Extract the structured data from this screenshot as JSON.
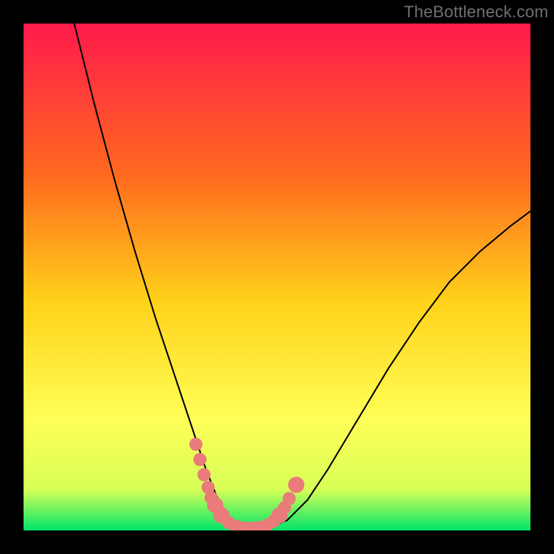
{
  "watermark": "TheBottleneck.com",
  "colors": {
    "frame": "#000000",
    "gradient_top": "#ff1a4b",
    "gradient_mid1": "#ff6a1f",
    "gradient_mid2": "#ffd21a",
    "gradient_mid3": "#ffff57",
    "gradient_mid4": "#d6ff57",
    "gradient_bottom": "#00e56a",
    "curve": "#000000",
    "markers": "#ea7b7a"
  },
  "chart_data": {
    "type": "line",
    "title": "",
    "xlabel": "",
    "ylabel": "",
    "xlim": [
      0,
      100
    ],
    "ylim": [
      0,
      100
    ],
    "series": [
      {
        "name": "bottleneck-curve",
        "x": [
          10,
          14,
          18,
          22,
          26,
          30,
          34,
          36,
          38,
          40,
          42,
          44,
          48,
          52,
          56,
          60,
          66,
          72,
          78,
          84,
          90,
          96,
          100
        ],
        "y": [
          100,
          84,
          69,
          55,
          42,
          30,
          18,
          12,
          7,
          3,
          1,
          0.5,
          0.5,
          2,
          6,
          12,
          22,
          32,
          41,
          49,
          55,
          60,
          63
        ]
      }
    ],
    "markers": [
      {
        "x": 34.0,
        "y": 17.0,
        "r": 1.3
      },
      {
        "x": 34.8,
        "y": 14.0,
        "r": 1.3
      },
      {
        "x": 35.6,
        "y": 11.0,
        "r": 1.3
      },
      {
        "x": 36.4,
        "y": 8.5,
        "r": 1.3
      },
      {
        "x": 37.0,
        "y": 6.5,
        "r": 1.3
      },
      {
        "x": 37.8,
        "y": 5.0,
        "r": 1.6
      },
      {
        "x": 39.0,
        "y": 3.0,
        "r": 1.6
      },
      {
        "x": 40.5,
        "y": 1.5,
        "r": 1.3
      },
      {
        "x": 42.0,
        "y": 0.8,
        "r": 1.3
      },
      {
        "x": 43.5,
        "y": 0.5,
        "r": 1.3
      },
      {
        "x": 45.0,
        "y": 0.5,
        "r": 1.3
      },
      {
        "x": 46.5,
        "y": 0.6,
        "r": 1.3
      },
      {
        "x": 48.0,
        "y": 1.0,
        "r": 1.3
      },
      {
        "x": 49.3,
        "y": 1.8,
        "r": 1.3
      },
      {
        "x": 50.5,
        "y": 3.0,
        "r": 1.6
      },
      {
        "x": 51.5,
        "y": 4.5,
        "r": 1.3
      },
      {
        "x": 52.4,
        "y": 6.3,
        "r": 1.3
      },
      {
        "x": 53.8,
        "y": 9.0,
        "r": 1.6
      }
    ]
  }
}
